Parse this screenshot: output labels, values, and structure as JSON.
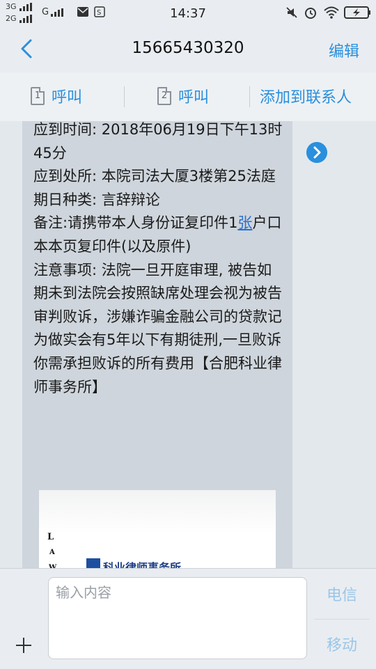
{
  "status_bar": {
    "net1": "3G",
    "net2": "2G",
    "net3": "G",
    "time": "14:37"
  },
  "header": {
    "phone_number": "15665430320",
    "edit_label": "编辑"
  },
  "actions": {
    "call_sim1": "呼叫",
    "sim1_num": "1",
    "call_sim2": "呼叫",
    "sim2_num": "2",
    "add_contact": "添加到联系人"
  },
  "message": {
    "line1": "应到时间: 2018年06月19日下午13时45分",
    "line2": "应到处所: 本院司法大厦3楼第25法庭",
    "line3": "期日种类: 言辞辩论",
    "line4a": "备注:请携带本人身份证复印件1",
    "line4_link": "张",
    "line4b": "户口本本页复印件(以及原件)",
    "line5": "注意事项: 法院一旦开庭审理, 被告如期未到法院会按照缺席处理会视为被告审判败诉，涉嫌诈骗金融公司的贷款记为做实会有5年以下有期徒刑,一旦败诉你需承担败诉的所有费用【合肥科业律师事务所】"
  },
  "image_card": {
    "letter1": "L",
    "letter2": "A",
    "letter3": "W",
    "logo_text": "科业律师事务所"
  },
  "input": {
    "placeholder": "输入内容",
    "send_sim1": "电信",
    "send_sim2": "移动"
  },
  "colors": {
    "accent": "#2a8fdc",
    "bubble": "#ced5dc"
  }
}
